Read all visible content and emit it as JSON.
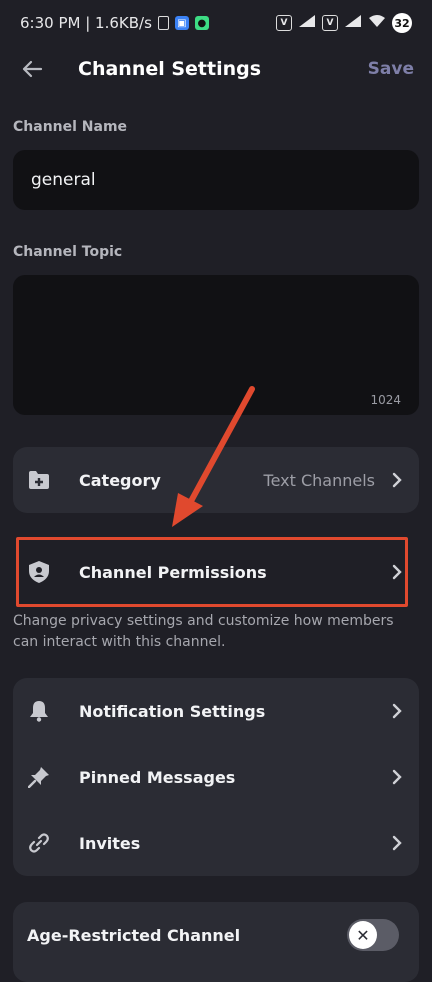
{
  "status_bar": {
    "time_speed": "6:30 PM | 1.6KB/s",
    "battery": "32"
  },
  "header": {
    "title": "Channel Settings",
    "save_label": "Save"
  },
  "channel_name": {
    "label": "Channel Name",
    "value": "general"
  },
  "channel_topic": {
    "label": "Channel Topic",
    "value": "",
    "counter": "1024"
  },
  "category": {
    "label": "Category",
    "value": "Text Channels"
  },
  "permissions": {
    "label": "Channel Permissions",
    "helper": "Change privacy settings and customize how members can interact with this channel."
  },
  "settings_list": [
    {
      "label": "Notification Settings",
      "icon": "bell-icon"
    },
    {
      "label": "Pinned Messages",
      "icon": "pin-icon"
    },
    {
      "label": "Invites",
      "icon": "link-icon"
    }
  ],
  "age_restricted": {
    "label": "Age-Restricted Channel",
    "enabled": false
  },
  "colors": {
    "background": "#1f1f26",
    "card": "#2b2c34",
    "input": "#111114",
    "annotation": "#e0492e",
    "save_disabled": "#7e7fa8"
  }
}
